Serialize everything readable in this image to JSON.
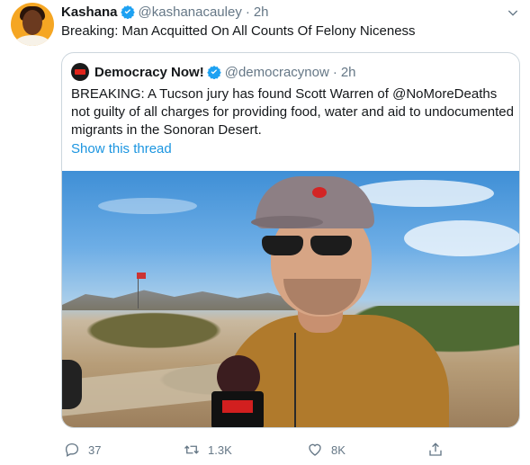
{
  "tweet": {
    "author_name": "Kashana",
    "author_handle": "@kashanacauley",
    "separator": "·",
    "time": "2h",
    "text": "Breaking: Man Acquitted On All Counts Of Felony Niceness",
    "avatar_icon": "profile-avatar"
  },
  "quoted": {
    "author_name": "Democracy Now!",
    "author_handle": "@democracynow",
    "separator": "·",
    "time": "2h",
    "text_before": "BREAKING: A Tucson jury has found Scott Warren of ",
    "mention": "@NoMoreDeaths",
    "text_after": " not guilty of all charges for providing food, water and aid to undocumented migrants in the Sonoran Desert.",
    "show_thread": "Show this thread",
    "media_icon": "video-still"
  },
  "actions": {
    "replies": "37",
    "retweets": "1.3K",
    "likes": "8K"
  },
  "colors": {
    "link": "#1b95e0",
    "verified": "#1da1f2",
    "secondary_text": "#657786",
    "border": "#ccd6dd"
  }
}
